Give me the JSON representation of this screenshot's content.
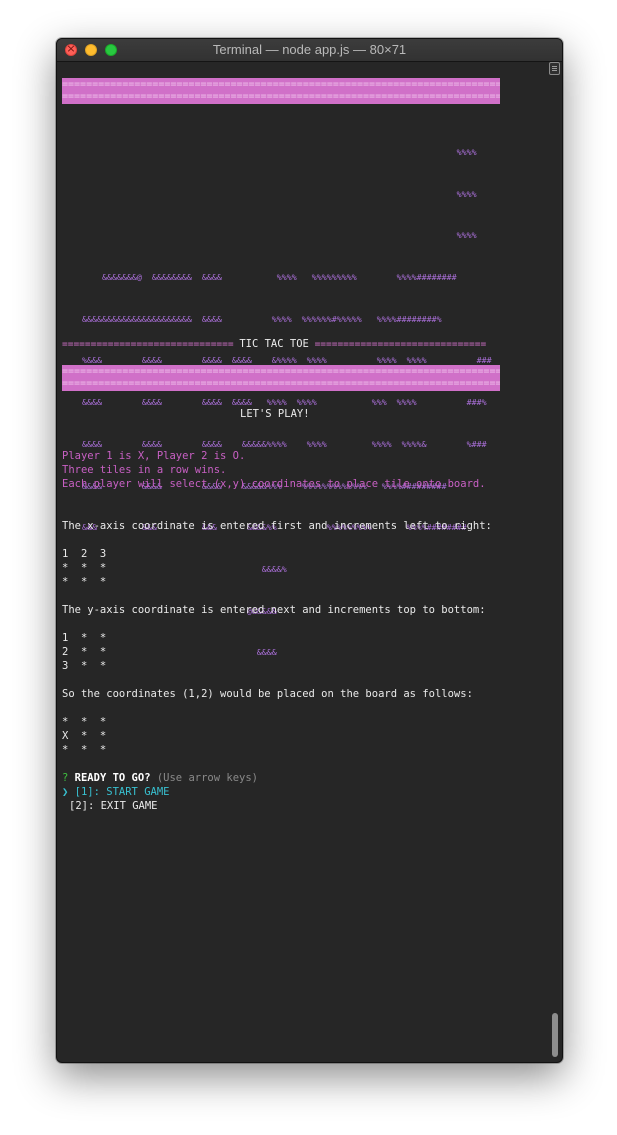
{
  "window": {
    "title": "Terminal — node app.js — 80×71"
  },
  "terminal": {
    "banner_line": "================================================================================",
    "ascii_art": [
      "                                                                               %%%%",
      "                                                                               %%%%",
      "                                                                               %%%%",
      "        &&&&&&&@  &&&&&&&&  &&&&           %%%%   %%%%%%%%%        %%%%########",
      "    &&&&&&&&&&&&&&&&&&&&&&  &&&&          %%%%  %%%%%%#%%%%%   %%%%########%",
      "    %&&&        &&&&        &&&&  &&&&    &%%%%  %%%%          %%%%  %%%%          ###",
      "    &&&&        &&&&        &&&&  &&&&   %%%%  %%%%           %%%  %%%%          ###%",
      "    &&&&        &&&&        &&&&    &&&&&%%%%    %%%%         %%%%  %%%%&        %###",
      "    &&&&        &&&&        &&&&    &&&&&%%%    %%%%%%%%%%%%%   %%%%#########",
      "    &&&         &&&         &&&      &&&&%%          %%%%%%%%%       %%%%########",
      "                                        &&&&%",
      "                                     @&&&&&",
      "                                       &&&&"
    ],
    "divider": {
      "left": "============================== ",
      "title": "TIC TAC TOE",
      "right": " =============================="
    },
    "lets_play": "LET'S PLAY!",
    "rules": [
      "Player 1 is X, Player 2 is O.",
      "Three tiles in a row wins.",
      "Each player will select (x,y) coordinates to place tile onto board."
    ],
    "x_axis_text": "The x-axis coordinate is entered first and increments left to right:",
    "x_axis_board": [
      "1  2  3",
      "*  *  *",
      "*  *  *"
    ],
    "y_axis_text": "The y-axis coordinate is entered next and increments top to bottom:",
    "y_axis_board": [
      "1  *  *",
      "2  *  *",
      "3  *  *"
    ],
    "example_text": "So the coordinates (1,2) would be placed on the board as follows:",
    "example_board": [
      "*  *  *",
      "X  *  *",
      "*  *  *"
    ],
    "prompt": {
      "mark": "?",
      "question": "READY TO GO?",
      "hint": "(Use arrow keys)",
      "pointer": "❯",
      "options": [
        "[1]: START GAME",
        "[2]: EXIT GAME"
      ]
    }
  },
  "colors": {
    "banner": "#d070c8",
    "art": "#a86ed6",
    "rules_text": "#c860c4",
    "prompt_mark": "#3fbf3f",
    "selected_option": "#38c0d0"
  }
}
